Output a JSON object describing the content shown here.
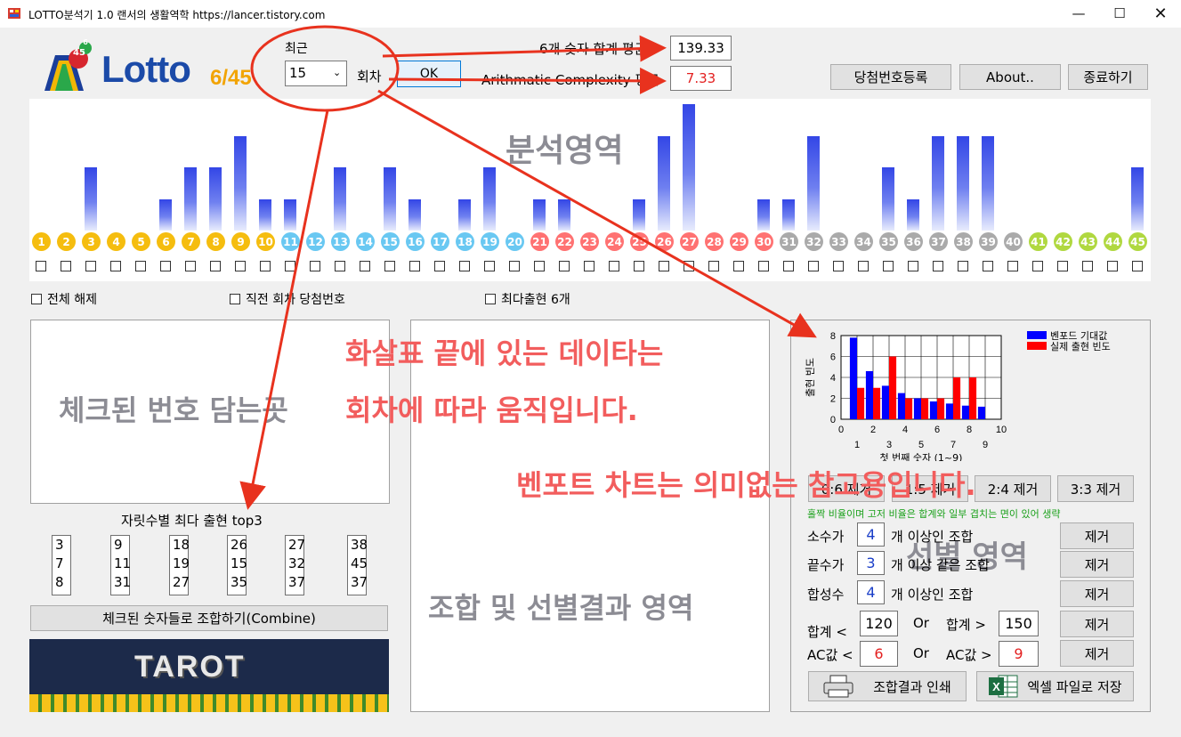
{
  "window": {
    "title": "LOTTO분석기 1.0  랜서의 생활역학 https://lancer.tistory.com"
  },
  "logo": {
    "text": "Lotto",
    "suffix": "6/45",
    "badge_small": "6",
    "badge_big": "45"
  },
  "recent": {
    "label": "최근",
    "value": "15",
    "unit": "회차",
    "ok_label": "OK"
  },
  "stats": {
    "sum_label": "6개 숫자 합계 평균",
    "sum_value": "139.33",
    "ac_label": "Arithmatic Complexity 평균",
    "ac_value": "7.33"
  },
  "header_buttons": {
    "register": "당첨번호등록",
    "about": "About..",
    "exit": "종료하기"
  },
  "analysis": {
    "overlay": "분석영역",
    "balls": [
      {
        "n": "1",
        "c": "#f5bd0f",
        "v": 0
      },
      {
        "n": "2",
        "c": "#f5bd0f",
        "v": 0
      },
      {
        "n": "3",
        "c": "#f5bd0f",
        "v": 2
      },
      {
        "n": "4",
        "c": "#f5bd0f",
        "v": 0
      },
      {
        "n": "5",
        "c": "#f5bd0f",
        "v": 0
      },
      {
        "n": "6",
        "c": "#f5bd0f",
        "v": 1
      },
      {
        "n": "7",
        "c": "#f5bd0f",
        "v": 2
      },
      {
        "n": "8",
        "c": "#f5bd0f",
        "v": 2
      },
      {
        "n": "9",
        "c": "#f5bd0f",
        "v": 3
      },
      {
        "n": "10",
        "c": "#f5bd0f",
        "v": 1
      },
      {
        "n": "11",
        "c": "#69c8f2",
        "v": 1
      },
      {
        "n": "12",
        "c": "#69c8f2",
        "v": 0
      },
      {
        "n": "13",
        "c": "#69c8f2",
        "v": 2
      },
      {
        "n": "14",
        "c": "#69c8f2",
        "v": 0
      },
      {
        "n": "15",
        "c": "#69c8f2",
        "v": 2
      },
      {
        "n": "16",
        "c": "#69c8f2",
        "v": 1
      },
      {
        "n": "17",
        "c": "#69c8f2",
        "v": 0
      },
      {
        "n": "18",
        "c": "#69c8f2",
        "v": 1
      },
      {
        "n": "19",
        "c": "#69c8f2",
        "v": 2
      },
      {
        "n": "20",
        "c": "#69c8f2",
        "v": 0
      },
      {
        "n": "21",
        "c": "#ff7272",
        "v": 1
      },
      {
        "n": "22",
        "c": "#ff7272",
        "v": 1
      },
      {
        "n": "23",
        "c": "#ff7272",
        "v": 0
      },
      {
        "n": "24",
        "c": "#ff7272",
        "v": 0
      },
      {
        "n": "25",
        "c": "#ff7272",
        "v": 1
      },
      {
        "n": "26",
        "c": "#ff7272",
        "v": 3
      },
      {
        "n": "27",
        "c": "#ff7272",
        "v": 4
      },
      {
        "n": "28",
        "c": "#ff7272",
        "v": 0
      },
      {
        "n": "29",
        "c": "#ff7272",
        "v": 0
      },
      {
        "n": "30",
        "c": "#ff7272",
        "v": 1
      },
      {
        "n": "31",
        "c": "#aaaaaa",
        "v": 1
      },
      {
        "n": "32",
        "c": "#aaaaaa",
        "v": 3
      },
      {
        "n": "33",
        "c": "#aaaaaa",
        "v": 0
      },
      {
        "n": "34",
        "c": "#aaaaaa",
        "v": 0
      },
      {
        "n": "35",
        "c": "#aaaaaa",
        "v": 2
      },
      {
        "n": "36",
        "c": "#aaaaaa",
        "v": 1
      },
      {
        "n": "37",
        "c": "#aaaaaa",
        "v": 3
      },
      {
        "n": "38",
        "c": "#aaaaaa",
        "v": 3
      },
      {
        "n": "39",
        "c": "#aaaaaa",
        "v": 3
      },
      {
        "n": "40",
        "c": "#aaaaaa",
        "v": 0
      },
      {
        "n": "41",
        "c": "#b0d840",
        "v": 0
      },
      {
        "n": "42",
        "c": "#b0d840",
        "v": 0
      },
      {
        "n": "43",
        "c": "#b0d840",
        "v": 0
      },
      {
        "n": "44",
        "c": "#b0d840",
        "v": 0
      },
      {
        "n": "45",
        "c": "#b0d840",
        "v": 2
      }
    ]
  },
  "options": {
    "clear_all": "전체 해제",
    "prev_draw": "직전 회차 당첨번호",
    "most_six": "최다출현 6개"
  },
  "checked_area": {
    "overlay": "체크된 번호 담는곳"
  },
  "top3": {
    "label": "자릿수별 최다 출현 top3",
    "columns": [
      [
        "3",
        "7",
        "8"
      ],
      [
        "9",
        "11",
        "31"
      ],
      [
        "18",
        "19",
        "27"
      ],
      [
        "26",
        "15",
        "35"
      ],
      [
        "27",
        "32",
        "37"
      ],
      [
        "38",
        "45",
        "37"
      ]
    ]
  },
  "combine_button": "체크된 숫자들로 조합하기(Combine)",
  "tarot": "TAROT",
  "result_area": {
    "overlay": "조합 및 선별결과 영역"
  },
  "annotations": {
    "line1": "화살표 끝에 있는 데이타는",
    "line2": "회차에 따라 움직입니다.",
    "line3": "벤포트 차트는 의미없는 참고용입니다."
  },
  "chart_data": {
    "type": "bar",
    "categories": [
      "1",
      "2",
      "3",
      "4",
      "5",
      "6",
      "7",
      "8",
      "9"
    ],
    "series": [
      {
        "name": "벤포드 기대값",
        "values": [
          7.8,
          4.6,
          3.2,
          2.5,
          2.0,
          1.7,
          1.5,
          1.3,
          1.2
        ],
        "color": "#0000ff"
      },
      {
        "name": "실제 출현 빈도",
        "values": [
          3,
          3,
          6,
          2,
          2,
          2,
          4,
          4,
          0
        ],
        "color": "#ff0000"
      }
    ],
    "xlabel": "첫 번째 숫자 (1~9)",
    "ylabel": "출현 빈도",
    "xlim": [
      0,
      10
    ],
    "ylim": [
      0,
      8
    ],
    "xticks_top": [
      "0",
      "2",
      "4",
      "6",
      "8",
      "10"
    ],
    "xticks_bottom": [
      "1",
      "3",
      "5",
      "7",
      "9"
    ],
    "yticks": [
      "0",
      "2",
      "4",
      "6",
      "8"
    ],
    "grid": true,
    "legend": "top-right"
  },
  "selection": {
    "elimination": [
      "0:6 제거",
      "1:5 제거",
      "2:4 제거",
      "3:3 제거"
    ],
    "note": "홀짝 비율이며 고저 비율은 합계와 일부 겹치는 면이 있어 생략",
    "overlay": "선별 영역",
    "rows": [
      {
        "prefix": "소수가",
        "value": "4",
        "suffix": "개 이상인 조합",
        "btn": "제거"
      },
      {
        "prefix": "끝수가",
        "value": "3",
        "suffix": "개 이상 같은 조합",
        "btn": "제거"
      },
      {
        "prefix": "합성수",
        "value": "4",
        "suffix": "개 이상인 조합",
        "btn": "제거"
      }
    ],
    "sum_row": {
      "left_label": "합계 <",
      "left_value": "120",
      "or": "Or",
      "right_label": "합계 >",
      "right_value": "150",
      "btn": "제거"
    },
    "ac_row": {
      "left_label": "AC값 <",
      "left_value": "6",
      "or": "Or",
      "right_label": "AC값 >",
      "right_value": "9",
      "btn": "제거"
    },
    "print_button": "조합결과 인쇄",
    "excel_button": "엑셀 파일로 저장"
  },
  "colors": {
    "accent_red": "#e8321e",
    "annotation": "#f25d5d",
    "bar_blue": "#3346e6"
  }
}
